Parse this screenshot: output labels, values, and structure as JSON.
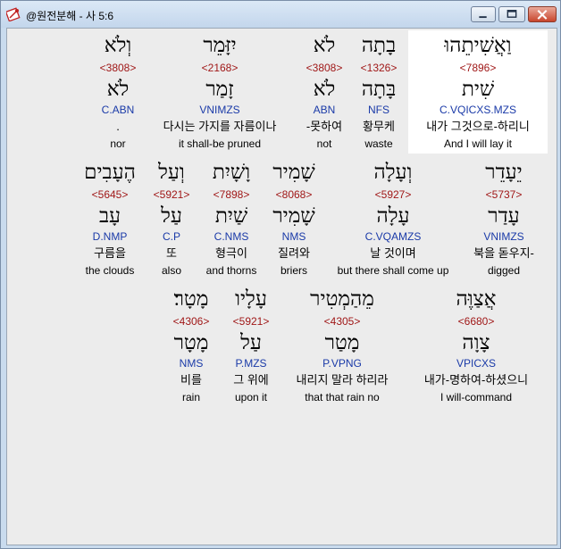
{
  "window": {
    "title": "@원전분해 - 사 5:6",
    "minimize_label": "minimize",
    "maximize_label": "maximize",
    "close_label": "close"
  },
  "rows": [
    {
      "words": [
        {
          "heb": "וְלֹא",
          "strong": "<3808>",
          "lemma": "לֹא",
          "morph": "C.ABN",
          "kor": ".",
          "eng": "nor"
        },
        {
          "heb": "יִזָּמֵר",
          "strong": "<2168>",
          "lemma": "זָמַר",
          "morph": "VNIMZS",
          "kor": "다시는 가지를 자름이나",
          "eng": "it shall-be pruned"
        },
        {
          "heb": "לֹא",
          "strong": "<3808>",
          "lemma": "לֹא",
          "morph": "ABN",
          "kor": "-못하여",
          "eng": "not"
        },
        {
          "heb": "בָתָה",
          "strong": "<1326>",
          "lemma": "בָּתָה",
          "morph": "NFS",
          "kor": "황무케",
          "eng": "waste"
        },
        {
          "heb": "וַאֲשִׁיתֵהוּ",
          "strong": "<7896>",
          "lemma": "שִׁית",
          "morph": "C.VQICXS.MZS",
          "kor": "내가 그것으로-하리니",
          "eng": "And I will lay it"
        }
      ]
    },
    {
      "words": [
        {
          "heb": "הֶעָבִים",
          "strong": "<5645>",
          "lemma": "עָב",
          "morph": "D.NMP",
          "kor": "구름을",
          "eng": "the clouds"
        },
        {
          "heb": "וְעַל",
          "strong": "<5921>",
          "lemma": "עַל",
          "morph": "C.P",
          "kor": "또",
          "eng": "also"
        },
        {
          "heb": "וָשָׁיִת",
          "strong": "<7898>",
          "lemma": "שַׁיִת",
          "morph": "C.NMS",
          "kor": "형극이",
          "eng": "and thorns"
        },
        {
          "heb": "שָׁמִיר",
          "strong": "<8068>",
          "lemma": "שָׁמִיר",
          "morph": "NMS",
          "kor": "질려와",
          "eng": "briers"
        },
        {
          "heb": "וְעָלָה",
          "strong": "<5927>",
          "lemma": "עָלָה",
          "morph": "C.VQAMZS",
          "kor": "날 것이며",
          "eng": "but there shall come up"
        },
        {
          "heb": "יֵעָדֵר",
          "strong": "<5737>",
          "lemma": "עָדַר",
          "morph": "VNIMZS",
          "kor": "북을 돋우지-",
          "eng": "digged"
        }
      ]
    },
    {
      "words": [
        {
          "heb": "מָטָר׃",
          "strong": "<4306>",
          "lemma": "מָטָר",
          "morph": "NMS",
          "kor": "비를",
          "eng": "rain"
        },
        {
          "heb": "עָלָיו",
          "strong": "<5921>",
          "lemma": "עַל",
          "morph": "P.MZS",
          "kor": "그 위에",
          "eng": "upon it"
        },
        {
          "heb": "מֵהַמְטִיר",
          "strong": "<4305>",
          "lemma": "מָטַר",
          "morph": "P.VPNG",
          "kor": "내리지 말라 하리라",
          "eng": "that that rain no"
        },
        {
          "heb": "אֲצַוֶּה",
          "strong": "<6680>",
          "lemma": "צָוָה",
          "morph": "VPICXS",
          "kor": "내가-명하여-하셨으니",
          "eng": "I will-command"
        }
      ]
    }
  ],
  "colors": {
    "strong": "#a01818",
    "morph": "#1a3aa8",
    "highlight": "#ffffff"
  }
}
